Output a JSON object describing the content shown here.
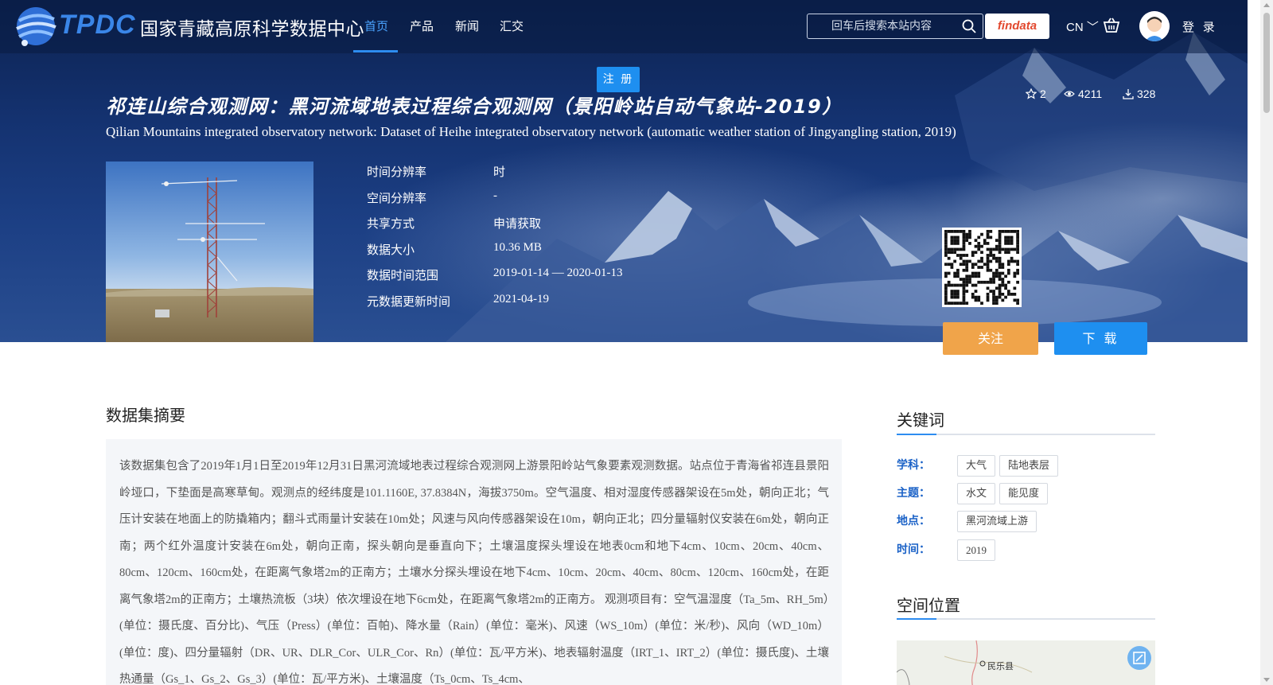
{
  "header": {
    "logo_abbr": "TPDC",
    "logo_name": "国家青藏高原科学数据中心",
    "nav": [
      {
        "label": "首页",
        "active": true
      },
      {
        "label": "产品",
        "active": false
      },
      {
        "label": "新闻",
        "active": false
      },
      {
        "label": "汇交",
        "active": false
      }
    ],
    "search_placeholder": "回车后搜索本站内容",
    "findata_label": "findata",
    "lang_label": "CN",
    "login_label": "登 录",
    "register_label": "注 册"
  },
  "dataset": {
    "title_cn": "祁连山综合观测网：黑河流域地表过程综合观测网（景阳岭站自动气象站-2019）",
    "title_en": "Qilian Mountains integrated observatory network: Dataset of Heihe integrated observatory network (automatic weather station of Jingyangling station, 2019)",
    "stars": "2",
    "views": "4211",
    "downloads": "328",
    "meta": [
      {
        "label": "时间分辨率",
        "value": "时"
      },
      {
        "label": "空间分辨率",
        "value": "-"
      },
      {
        "label": "共享方式",
        "value": "申请获取"
      },
      {
        "label": "数据大小",
        "value": "10.36 MB"
      },
      {
        "label": "数据时间范围",
        "value": "2019-01-14 — 2020-01-13"
      },
      {
        "label": "元数据更新时间",
        "value": "2021-04-19"
      }
    ],
    "follow_label": "关注",
    "download_label": "下 载"
  },
  "abstract": {
    "heading": "数据集摘要",
    "text": "该数据集包含了2019年1月1日至2019年12月31日黑河流域地表过程综合观测网上游景阳岭站气象要素观测数据。站点位于青海省祁连县景阳岭垭口，下垫面是高寒草甸。观测点的经纬度是101.1160E, 37.8384N，海拔3750m。空气温度、相对湿度传感器架设在5m处，朝向正北；气压计安装在地面上的防撬箱内；翻斗式雨量计安装在10m处；风速与风向传感器架设在10m，朝向正北；四分量辐射仪安装在6m处，朝向正南；两个红外温度计安装在6m处，朝向正南，探头朝向是垂直向下；土壤温度探头埋设在地表0cm和地下4cm、10cm、20cm、40cm、80cm、120cm、160cm处，在距离气象塔2m的正南方；土壤水分探头埋设在地下4cm、10cm、20cm、40cm、80cm、120cm、160cm处，在距离气象塔2m的正南方；土壤热流板（3块）依次埋设在地下6cm处，在距离气象塔2m的正南方。 观测项目有：空气温湿度（Ta_5m、RH_5m）(单位：摄氏度、百分比)、气压（Press）(单位：百帕)、降水量（Rain）(单位：毫米)、风速（WS_10m）(单位：米/秒)、风向（WD_10m）(单位：度)、四分量辐射（DR、UR、DLR_Cor、ULR_Cor、Rn）(单位：瓦/平方米)、地表辐射温度（IRT_1、IRT_2）(单位：摄氏度)、土壤热通量（Gs_1、Gs_2、Gs_3）(单位：瓦/平方米)、土壤温度（Ts_0cm、Ts_4cm、"
  },
  "keywords": {
    "heading": "关键词",
    "groups": [
      {
        "label": "学科：",
        "tags": [
          "大气",
          "陆地表层"
        ]
      },
      {
        "label": "主题：",
        "tags": [
          "水文",
          "能见度"
        ]
      },
      {
        "label": "地点：",
        "tags": [
          "黑河流域上游"
        ]
      },
      {
        "label": "时间：",
        "tags": [
          "2019"
        ]
      }
    ]
  },
  "spatial": {
    "heading": "空间位置",
    "map_place": "民乐县"
  },
  "colors": {
    "accent": "#2d8cf0",
    "follow": "#f0a44a",
    "download": "#1e8ff0",
    "keyword_label": "#1b62c7"
  }
}
